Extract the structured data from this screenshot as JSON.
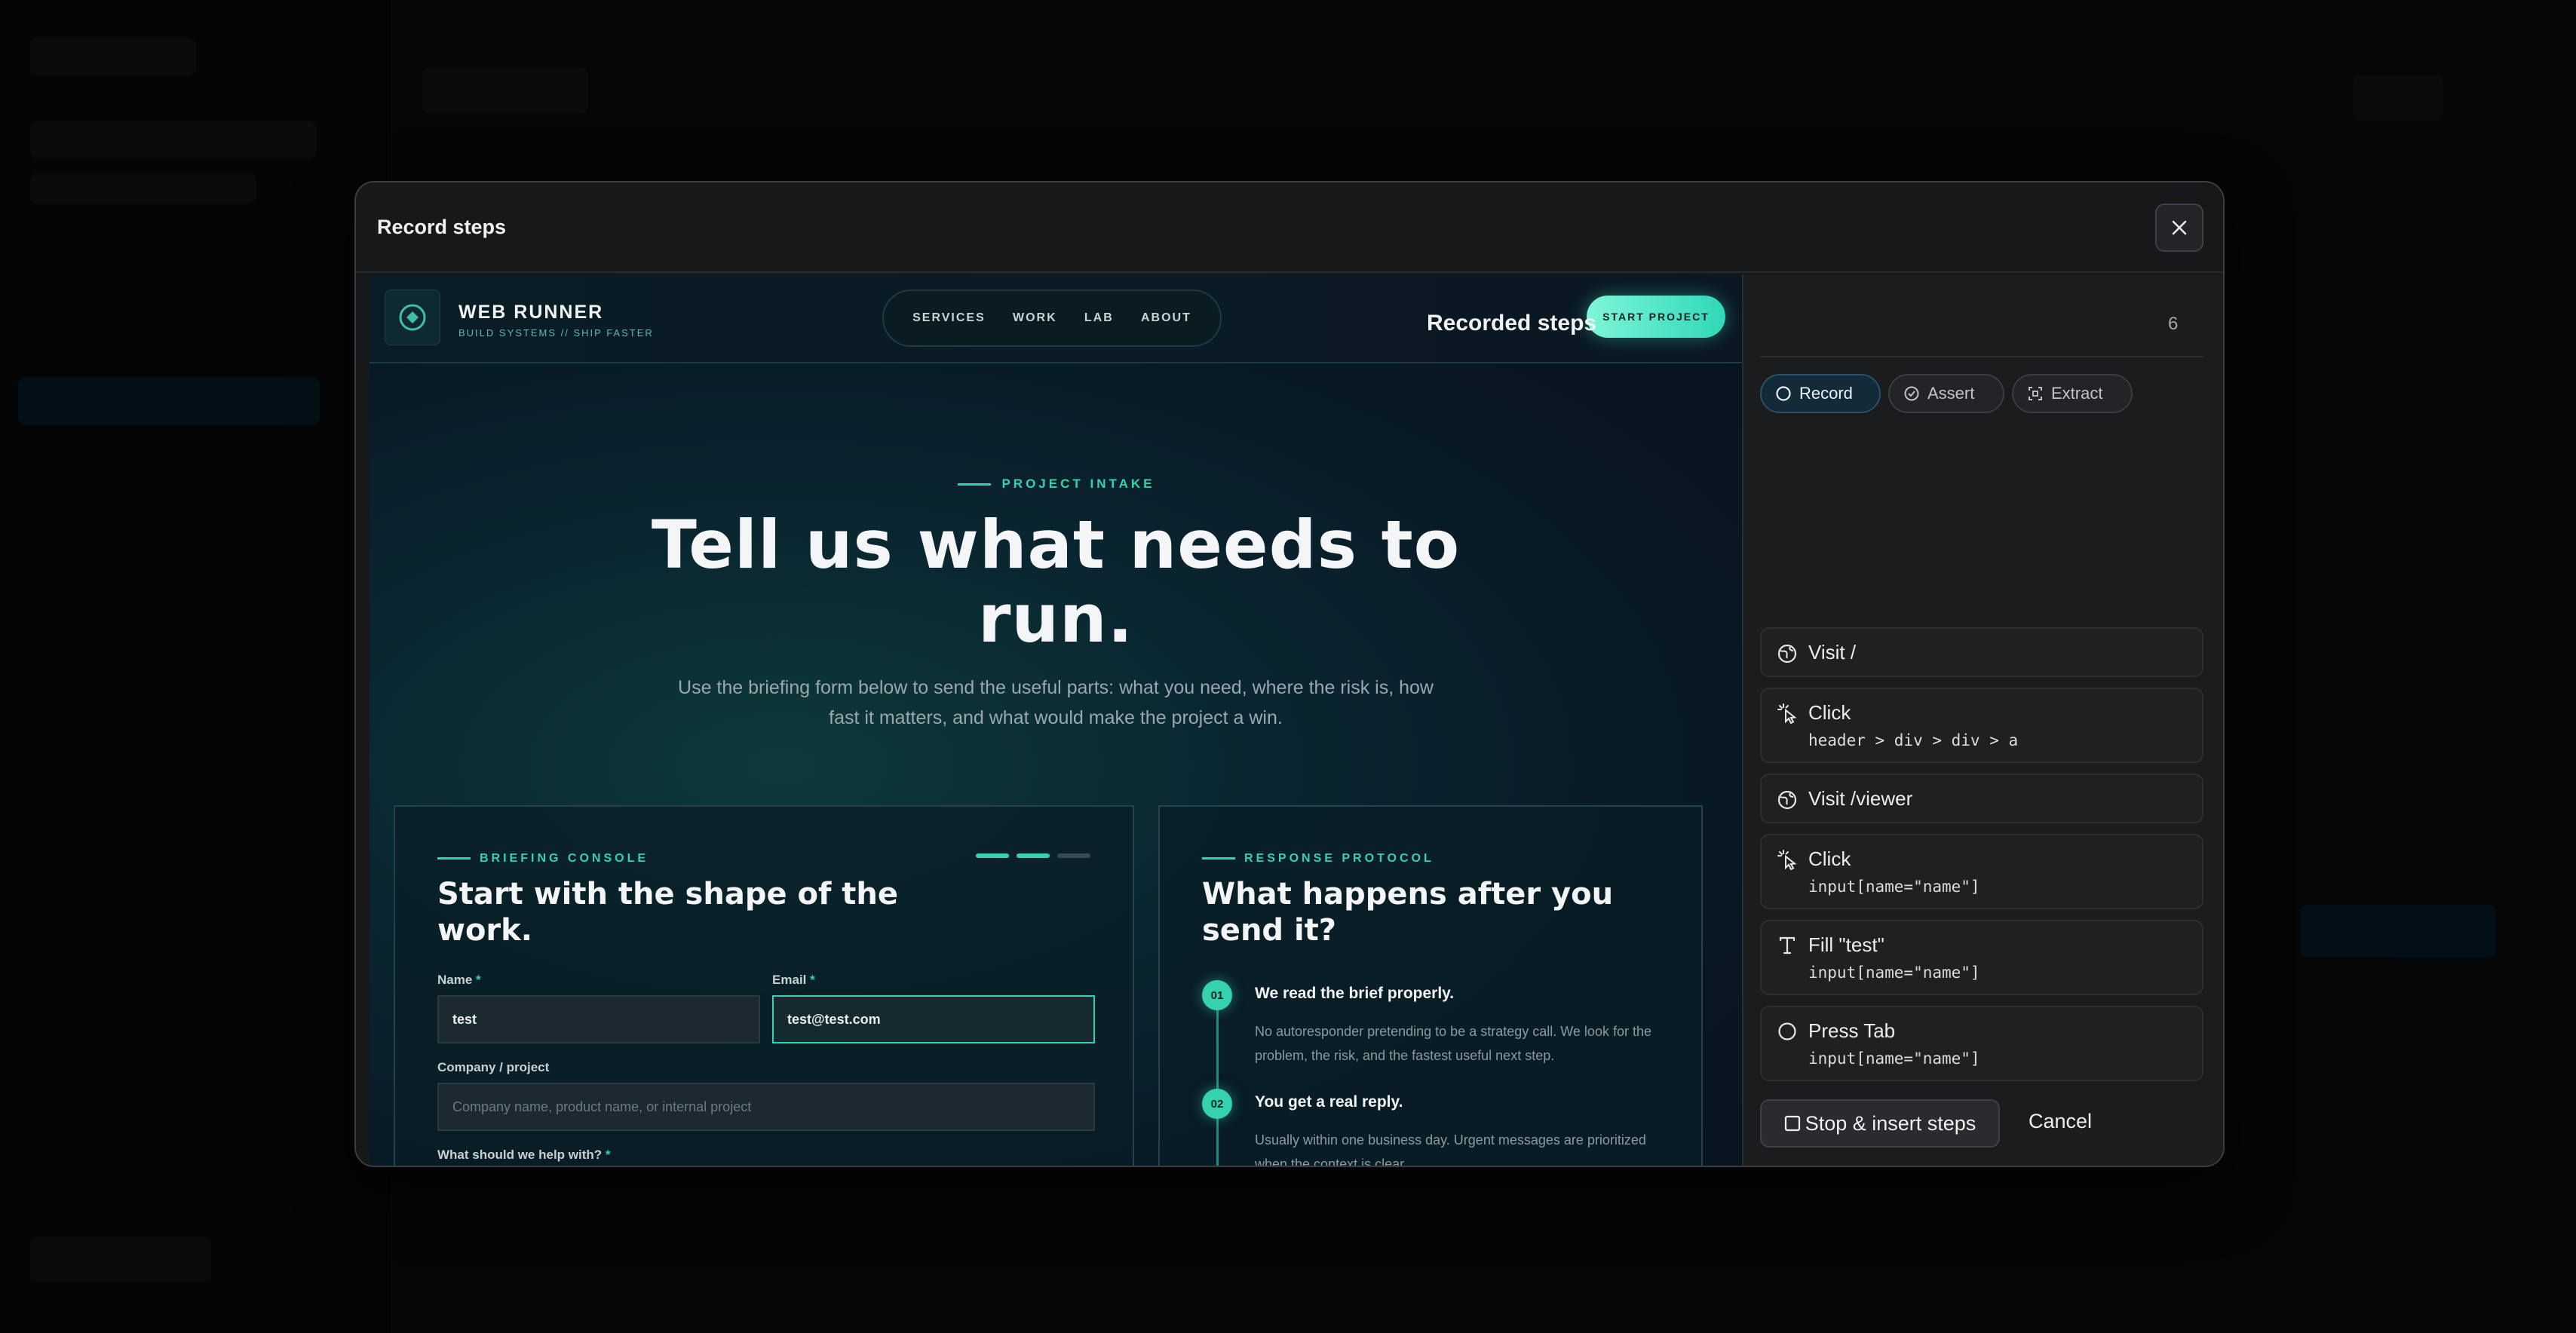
{
  "modal": {
    "title": "Record steps",
    "close_icon": "close-icon"
  },
  "preview": {
    "brand": "WEB RUNNER",
    "tagline": "BUILD SYSTEMS // SHIP FASTER",
    "nav": [
      "SERVICES",
      "WORK",
      "LAB",
      "ABOUT"
    ],
    "cta": "START PROJECT",
    "eyebrow": "PROJECT INTAKE",
    "hero_line1": "Tell us what needs to",
    "hero_line2": "run.",
    "subtext": "Use the briefing form below to send the useful parts: what you need, where the risk is, how fast it matters, and what would make the project a win.",
    "left_card": {
      "eyebrow": "BRIEFING CONSOLE",
      "title": "Start with the shape of the work.",
      "name_label": "Name",
      "name_value": "test",
      "email_label": "Email",
      "email_value": "test@test.com",
      "company_label": "Company / project",
      "company_placeholder": "Company name, product name, or internal project",
      "help_label": "What should we help with?",
      "required_mark": "*"
    },
    "right_card": {
      "eyebrow": "RESPONSE PROTOCOL",
      "title": "What happens after you send it?",
      "steps": [
        {
          "num": "01",
          "head": "We read the brief properly.",
          "body": "No autoresponder pretending to be a strategy call. We look for the problem, the risk, and the fastest useful next step."
        },
        {
          "num": "02",
          "head": "You get a real reply.",
          "body": "Usually within one business day. Urgent messages are prioritized when the context is clear."
        }
      ]
    }
  },
  "panel": {
    "title": "Recorded steps",
    "count": "6",
    "modes": [
      {
        "label": "Record",
        "icon": "circle-icon",
        "active": true
      },
      {
        "label": "Assert",
        "icon": "check-circle-icon",
        "active": false
      },
      {
        "label": "Extract",
        "icon": "scan-icon",
        "active": false
      }
    ],
    "steps": [
      {
        "title": "Visit /",
        "selector": "",
        "icon": "globe-icon"
      },
      {
        "title": "Click",
        "selector": "header > div > div > a",
        "icon": "pointer-click-icon"
      },
      {
        "title": "Visit /viewer",
        "selector": "",
        "icon": "globe-icon"
      },
      {
        "title": "Click",
        "selector": "input[name=\"name\"]",
        "icon": "pointer-click-icon"
      },
      {
        "title": "Fill \"test\"",
        "selector": "input[name=\"name\"]",
        "icon": "text-icon"
      },
      {
        "title": "Press Tab",
        "selector": "input[name=\"name\"]",
        "icon": "circle-icon"
      }
    ],
    "stop_label": "Stop & insert steps",
    "cancel_label": "Cancel"
  },
  "colors": {
    "accent": "#35d2b0",
    "modal_bg": "#17181a",
    "active_mode": "#132a38"
  }
}
